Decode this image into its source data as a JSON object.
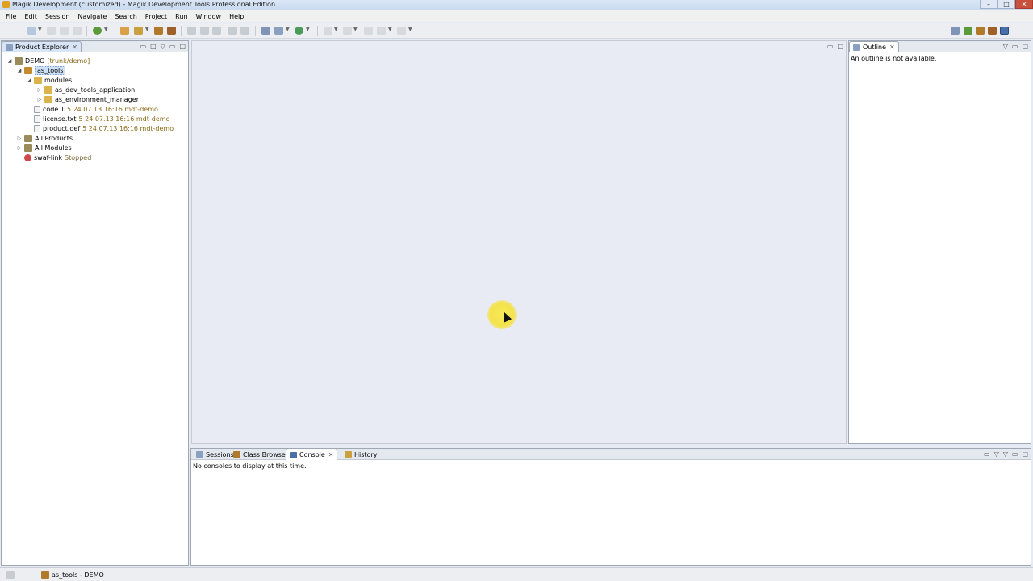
{
  "window": {
    "title": "Magik Development (customized) - Magik Development Tools Professional Edition",
    "controls": {
      "minimize": "–",
      "maximize": "□",
      "close": "✕"
    }
  },
  "menu": [
    "File",
    "Edit",
    "Session",
    "Navigate",
    "Search",
    "Project",
    "Run",
    "Window",
    "Help"
  ],
  "product_explorer": {
    "tab_label": "Product Explorer",
    "close": "✕",
    "tree": [
      {
        "label": "DEMO",
        "decoration": "[trunk/demo]"
      },
      {
        "label": "as_tools",
        "decoration": ""
      },
      {
        "label": "modules",
        "decoration": ""
      },
      {
        "label": "as_dev_tools_application",
        "decoration": ""
      },
      {
        "label": "as_environment_manager",
        "decoration": ""
      },
      {
        "label": "code.1",
        "decoration": "5  24.07.13 16:16  mdt-demo"
      },
      {
        "label": "license.txt",
        "decoration": "5  24.07.13 16:16  mdt-demo"
      },
      {
        "label": "product.def",
        "decoration": "5  24.07.13 16:16  mdt-demo"
      },
      {
        "label": "All Products",
        "decoration": ""
      },
      {
        "label": "All Modules",
        "decoration": ""
      },
      {
        "label": "swaf-link",
        "decoration": "Stopped"
      }
    ],
    "twisties": {
      "expanded": "◢",
      "collapsed": "▷"
    }
  },
  "outline": {
    "tab_label": "Outline",
    "close": "✕",
    "message": "An outline is not available."
  },
  "bottom_panel": {
    "tabs": [
      {
        "label": "Sessions"
      },
      {
        "label": "Class Browser"
      },
      {
        "label": "Console",
        "close": "✕"
      },
      {
        "label": "History"
      }
    ],
    "message": "No consoles to display at this time."
  },
  "panel_controls": {
    "minimize": "▭",
    "maximize": "□",
    "menu": "▽"
  },
  "status_bar": {
    "text": "as_tools - DEMO"
  },
  "colors": {
    "accent": "#cde0f7",
    "folder": "#d9b44a",
    "decoration": "#8a6a1a",
    "error": "#d0494a"
  }
}
